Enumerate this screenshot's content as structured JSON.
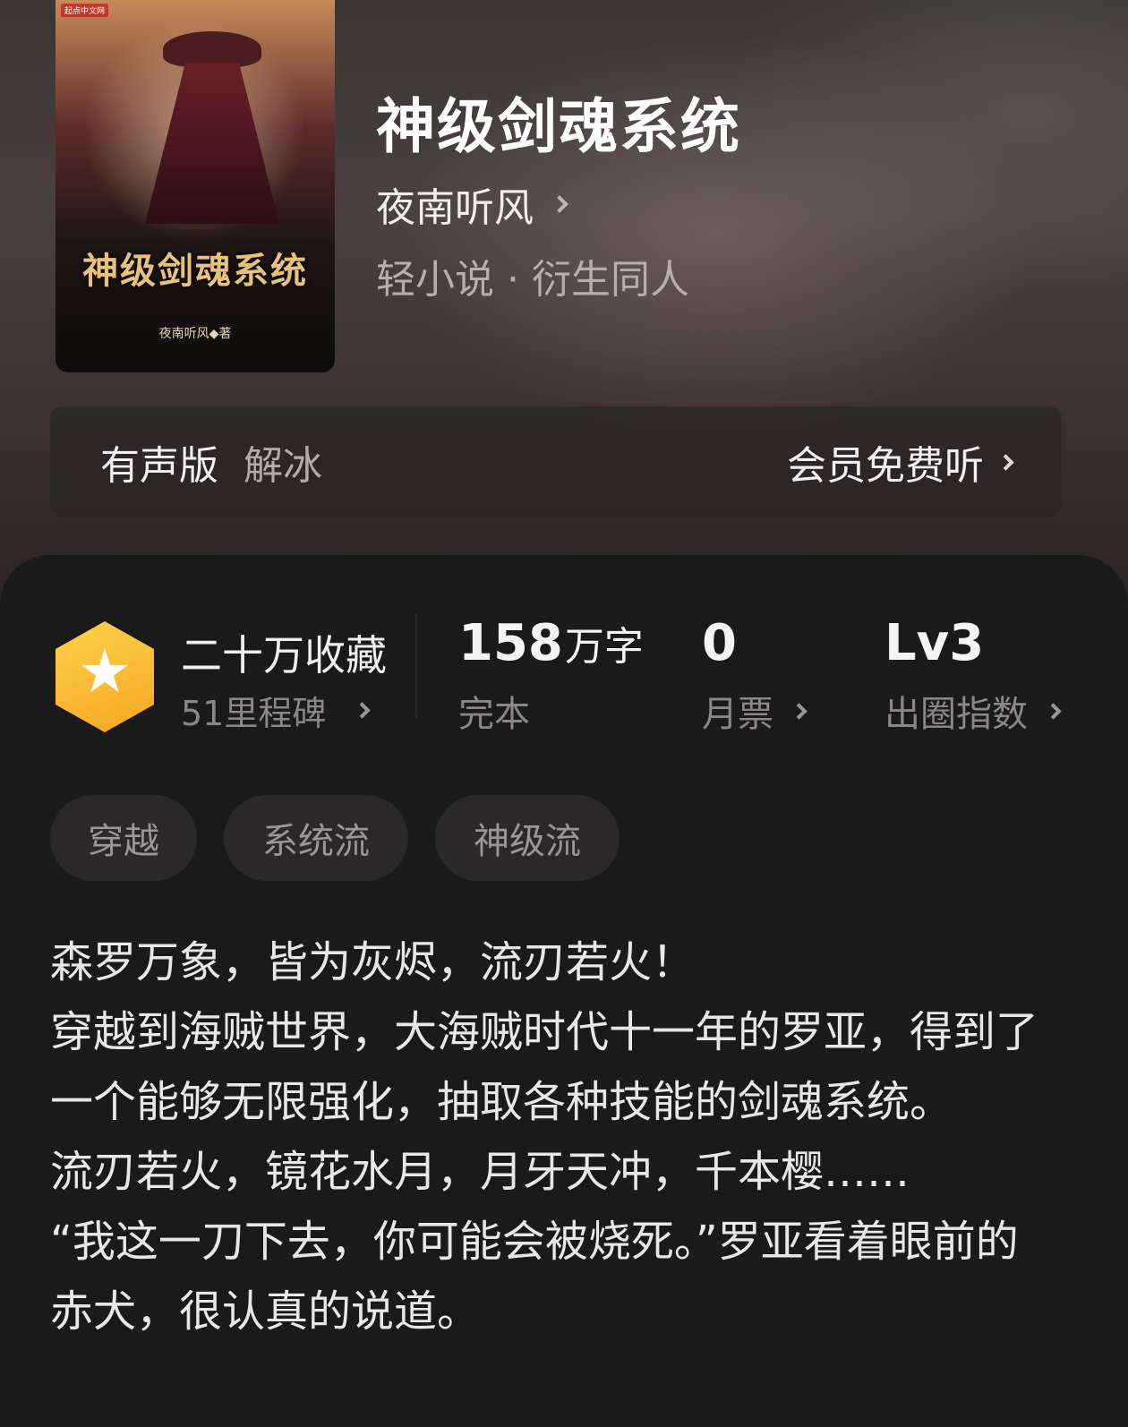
{
  "book": {
    "title": "神级剑魂系统",
    "author": "夜南听风",
    "genre": "轻小说 · 衍生同人",
    "cover": {
      "publisher_badge": "起点中文网",
      "title_art": "神级剑魂系统",
      "author_line": "夜南听风◆著"
    }
  },
  "audio": {
    "label": "有声版",
    "narrator": "解冰",
    "action": "会员免费听"
  },
  "stats": {
    "favorites": "二十万收藏",
    "milestones": "51里程碑",
    "word_count": "158",
    "word_unit": "万字",
    "status": "完本",
    "monthly_votes": "0",
    "monthly_votes_label": "月票",
    "level": "Lv3",
    "level_label": "出圈指数"
  },
  "tags": [
    "穿越",
    "系统流",
    "神级流"
  ],
  "description": [
    "森罗万象，皆为灰烬，流刃若火！",
    "穿越到海贼世界，大海贼时代十一年的罗亚，得到了一个能够无限强化，抽取各种技能的剑魂系统。",
    "流刃若火，镜花水月，月牙天冲，千本樱……",
    "“我这一刀下去，你可能会被烧死。”罗亚看着眼前的赤犬，很认真的说道。"
  ],
  "colors": {
    "badge": "#f5a623",
    "background": "#1b1a1a",
    "tag_bg": "#2a2828"
  },
  "icons": [
    "chevron-right-icon",
    "star-icon"
  ]
}
